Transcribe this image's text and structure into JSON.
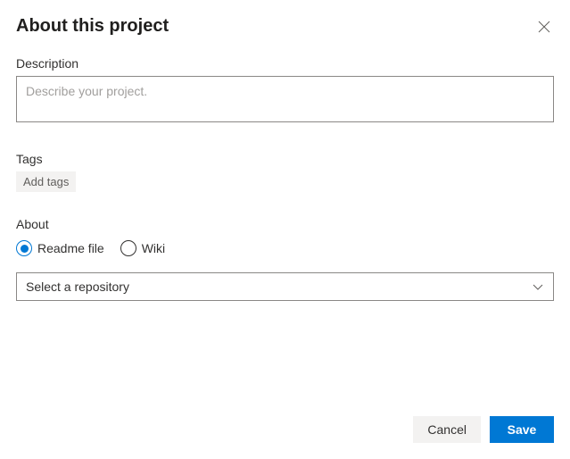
{
  "header": {
    "title": "About this project"
  },
  "description": {
    "label": "Description",
    "placeholder": "Describe your project.",
    "value": ""
  },
  "tags": {
    "label": "Tags",
    "add_label": "Add tags"
  },
  "about": {
    "label": "About",
    "options": {
      "readme": "Readme file",
      "wiki": "Wiki"
    },
    "selected": "readme",
    "repo_dropdown": {
      "selected": "Select a repository"
    }
  },
  "footer": {
    "cancel": "Cancel",
    "save": "Save"
  }
}
